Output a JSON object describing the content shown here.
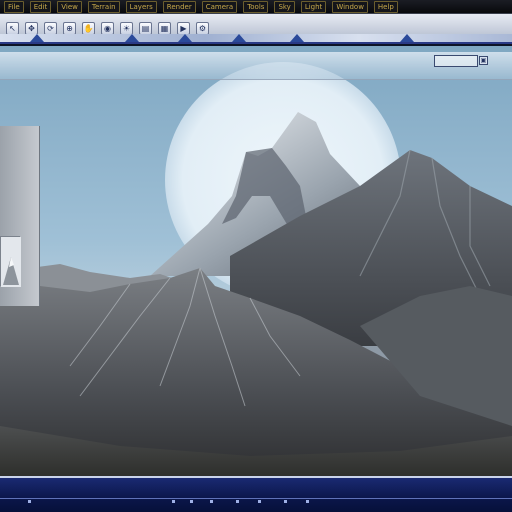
{
  "menubar": {
    "items": [
      "File",
      "Edit",
      "View",
      "Terrain",
      "Layers",
      "Render",
      "Camera",
      "Tools",
      "Sky",
      "Light",
      "Window",
      "Help"
    ]
  },
  "toolbar": {
    "buttons": [
      {
        "icon": "pointer-icon",
        "glyph": "↖"
      },
      {
        "icon": "move-icon",
        "glyph": "✥"
      },
      {
        "icon": "rotate-icon",
        "glyph": "⟳"
      },
      {
        "icon": "zoom-icon",
        "glyph": "⊕"
      },
      {
        "icon": "pan-icon",
        "glyph": "✋"
      },
      {
        "icon": "camera-icon",
        "glyph": "◉"
      },
      {
        "icon": "light-icon",
        "glyph": "☀"
      },
      {
        "icon": "layer-icon",
        "glyph": "▤"
      },
      {
        "icon": "grid-icon",
        "glyph": "▦"
      },
      {
        "icon": "render-icon",
        "glyph": "▶"
      },
      {
        "icon": "settings-icon",
        "glyph": "⚙"
      }
    ]
  },
  "viewport": {
    "info_text": "",
    "coord_readout": "",
    "map_glyph": "▣"
  },
  "labels": {
    "primary": "",
    "secondary": ""
  },
  "status": {
    "text": ""
  },
  "colors": {
    "accent": "#2a3a86",
    "menu_text": "#c6a84a",
    "label_red": "#ff3a3a"
  }
}
